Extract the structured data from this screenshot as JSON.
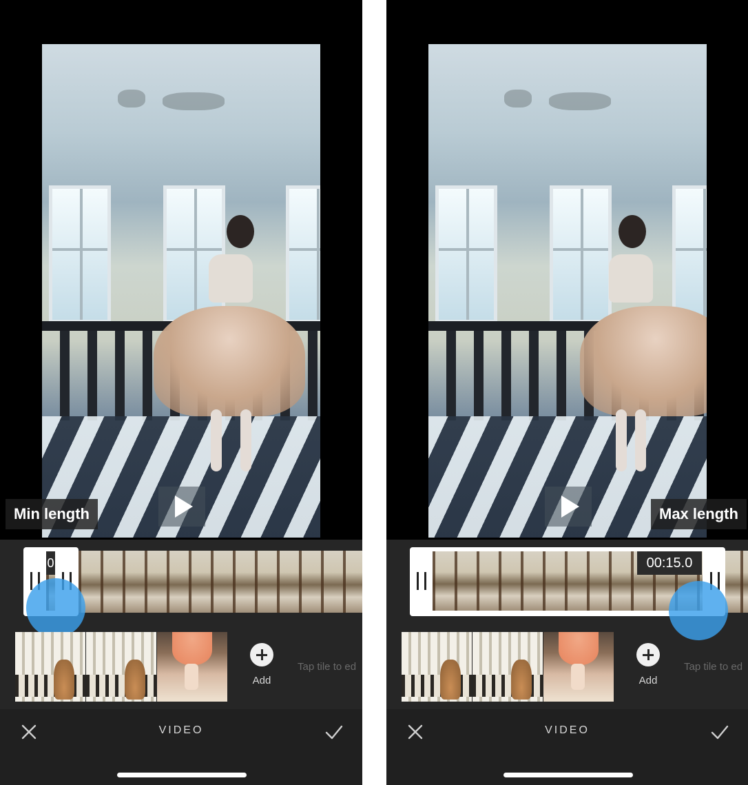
{
  "screens": [
    {
      "id": "left",
      "tooltip": "Min length",
      "trim_time": "0",
      "add_label": "Add",
      "hint": "Tap tile to ed",
      "title": "VIDEO"
    },
    {
      "id": "right",
      "tooltip": "Max length",
      "trim_time": "00:15.0",
      "add_label": "Add",
      "hint": "Tap tile to ed",
      "title": "VIDEO"
    }
  ],
  "icons": {
    "play": "play-icon",
    "add": "plus-icon",
    "cancel": "close-icon",
    "confirm": "checkmark-icon"
  },
  "colors": {
    "panel": "#262626",
    "bar": "#202020",
    "touch": "#3ca0eb"
  }
}
